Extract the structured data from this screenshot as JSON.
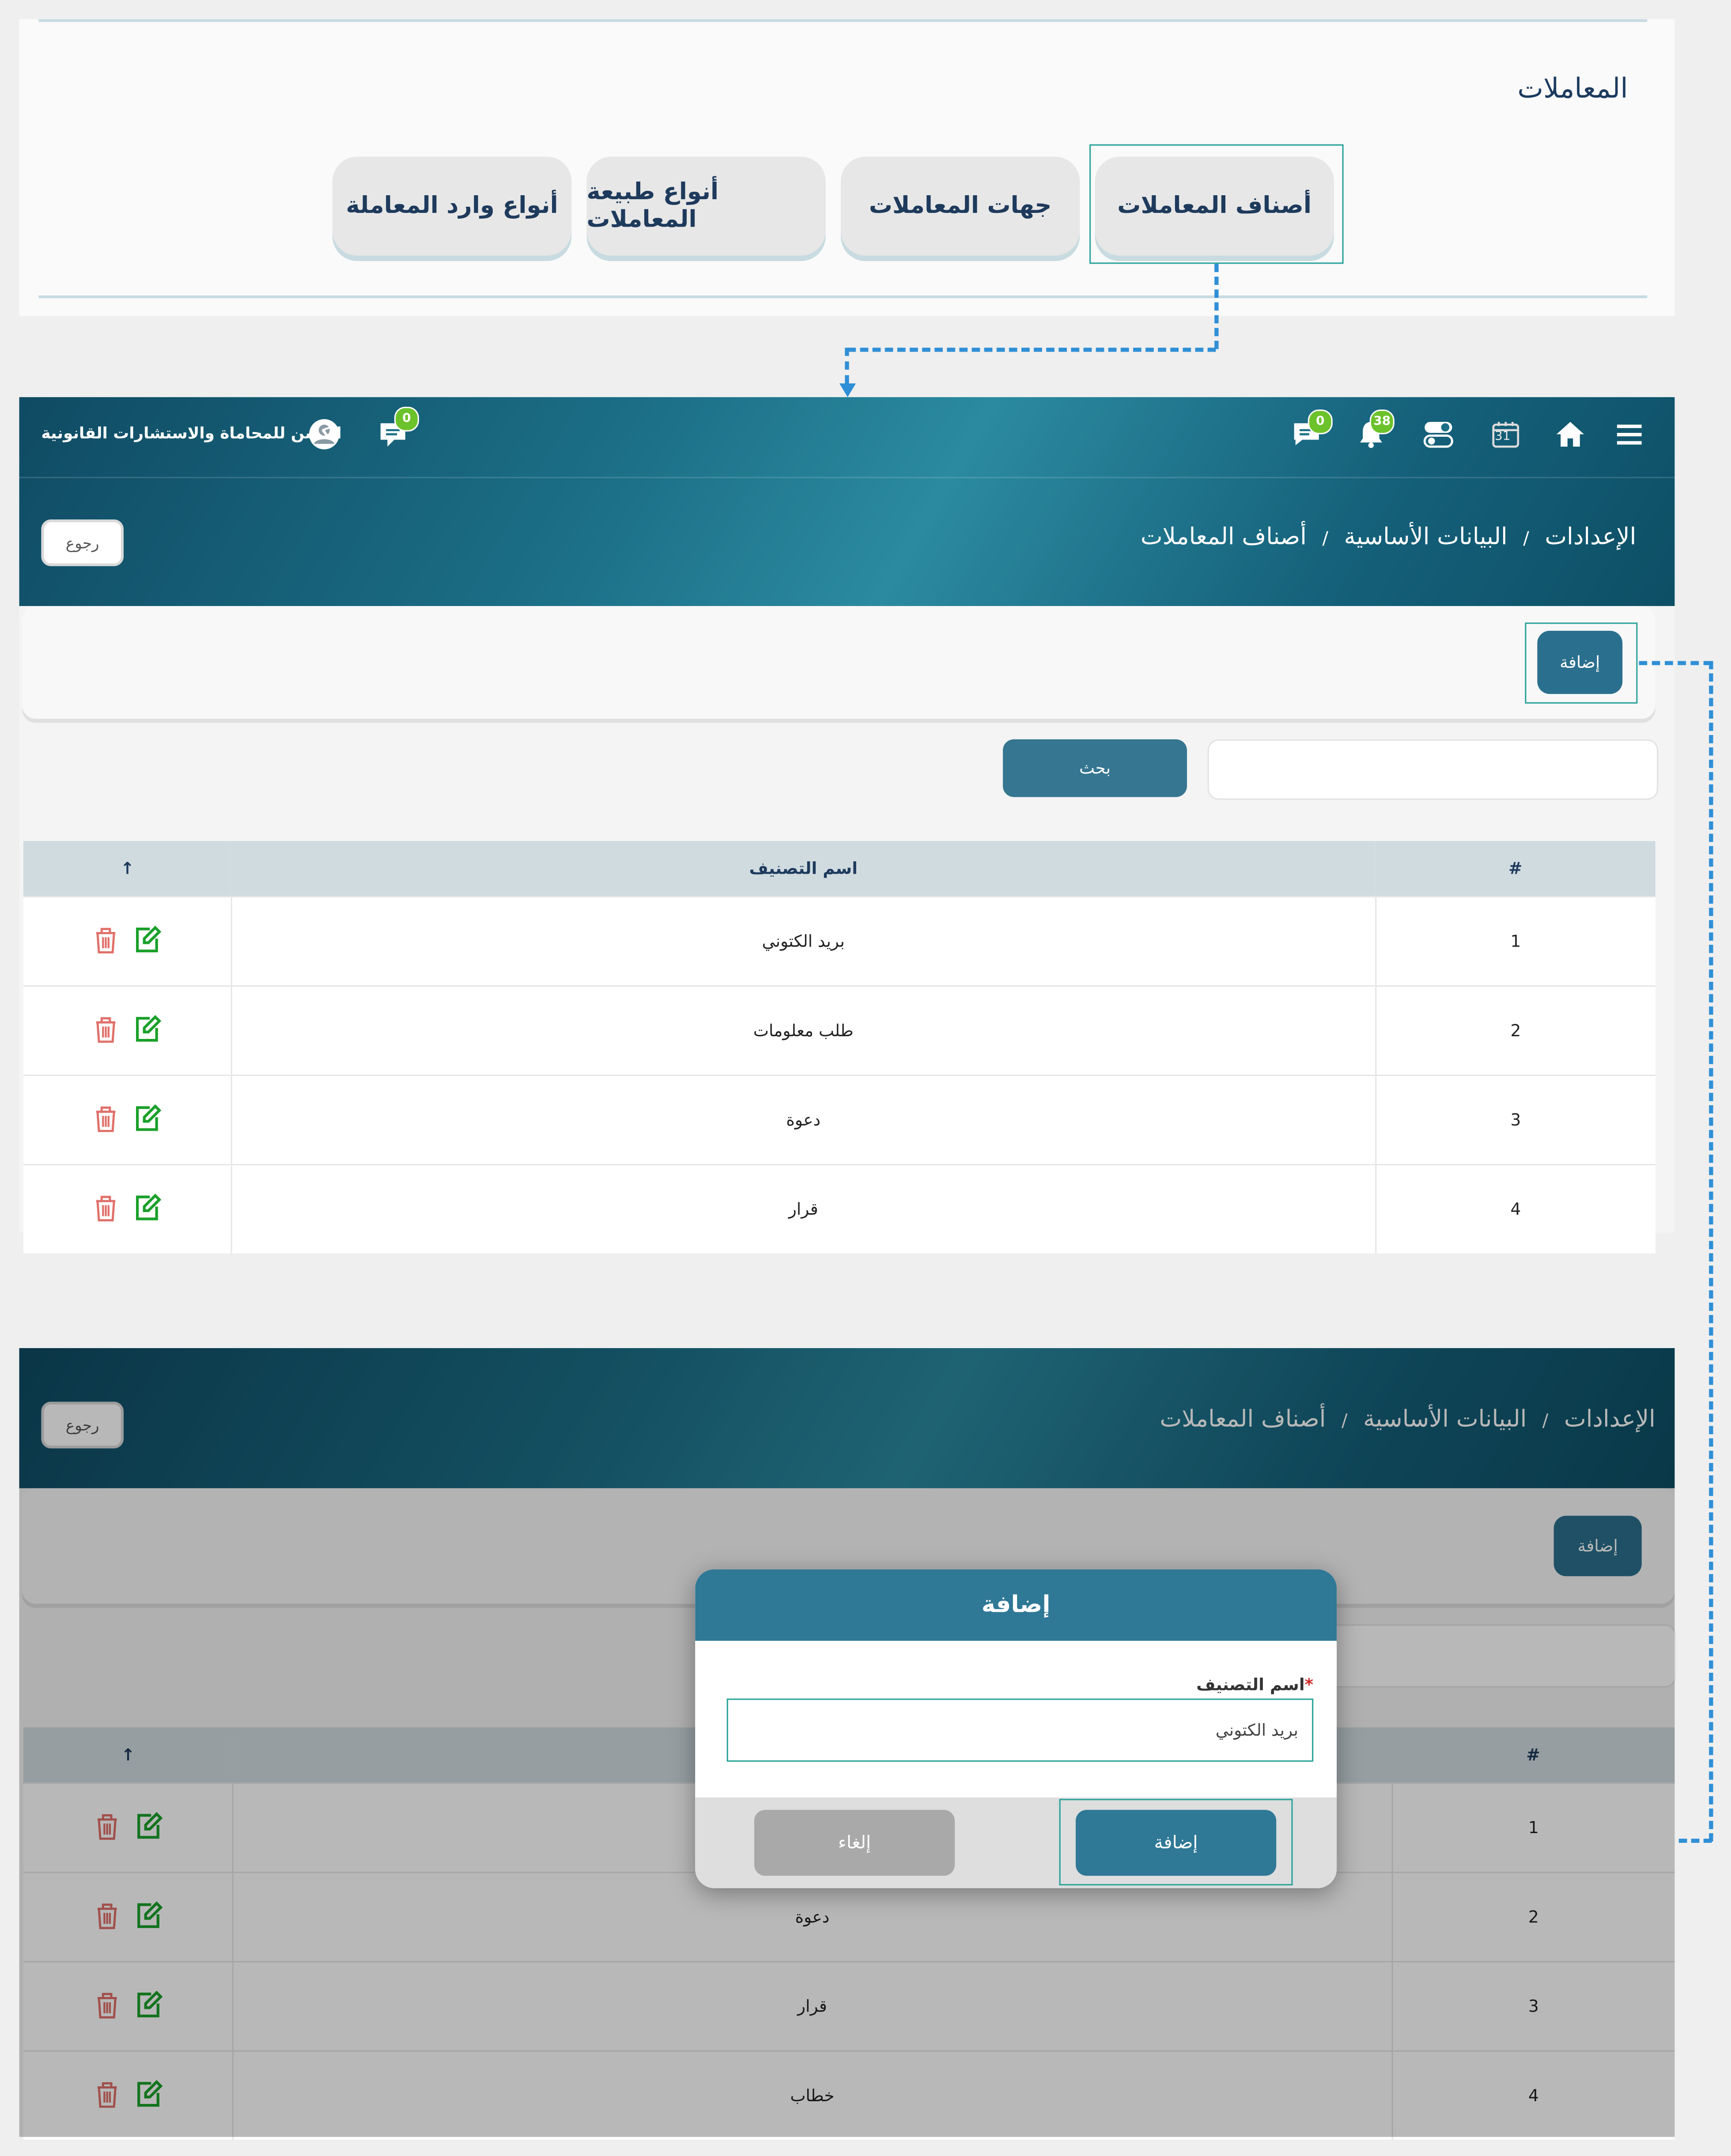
{
  "colors": {
    "accent": "#2b6f8e",
    "highlight": "#2aa39a",
    "connector": "#2f8fd6",
    "badge": "#6cc22b",
    "header_dark": "#0f4b63"
  },
  "panel": {
    "title": "المعاملات",
    "tabs": [
      "أصناف المعاملات",
      "جهات المعاملات",
      "أنواع طبيعة المعاملات",
      "أنواع وارد المعاملة"
    ]
  },
  "screen1": {
    "brand": "الكشن للمحاماة والاستشارات القانونية",
    "badges": {
      "messages_right": "0",
      "notifications": "38",
      "messages_left": "0"
    },
    "calendar_day": "31",
    "icons": [
      "menu-icon",
      "home-icon",
      "calendar-icon",
      "toggle-icon",
      "bell-icon",
      "chat-icon",
      "user-icon",
      "comment-icon"
    ],
    "breadcrumb": {
      "level1": "الإعدادات",
      "level2": "البيانات الأساسية",
      "level3": "أصناف المعاملات",
      "sep": "/"
    },
    "back_label": "رجوع",
    "add_label": "إضافة",
    "search_label": "بحث",
    "search_placeholder": "",
    "table": {
      "headers": {
        "num": "#",
        "name": "اسم التصنيف",
        "sort": "↑"
      },
      "rows": [
        {
          "num": "1",
          "name": "بريد الكتوني"
        },
        {
          "num": "2",
          "name": "طلب معلومات"
        },
        {
          "num": "3",
          "name": "دعوة"
        },
        {
          "num": "4",
          "name": "قرار"
        }
      ]
    }
  },
  "screen2": {
    "breadcrumb": {
      "level1": "الإعدادات",
      "level2": "البيانات الأساسية",
      "level3": "أصناف المعاملات",
      "sep": "/"
    },
    "back_label": "رجوع",
    "add_label": "إضافة",
    "table": {
      "headers": {
        "num": "#",
        "sort": "↑"
      },
      "rows": [
        {
          "num": "1",
          "name": ""
        },
        {
          "num": "2",
          "name": "دعوة"
        },
        {
          "num": "3",
          "name": "قرار"
        },
        {
          "num": "4",
          "name": "خطاب"
        }
      ]
    },
    "modal": {
      "title": "إضافة",
      "field_label": "اسم التصنيف",
      "required_mark": "*",
      "field_value": "بريد الكتوني",
      "submit_label": "إضافة",
      "cancel_label": "إلغاء"
    }
  }
}
